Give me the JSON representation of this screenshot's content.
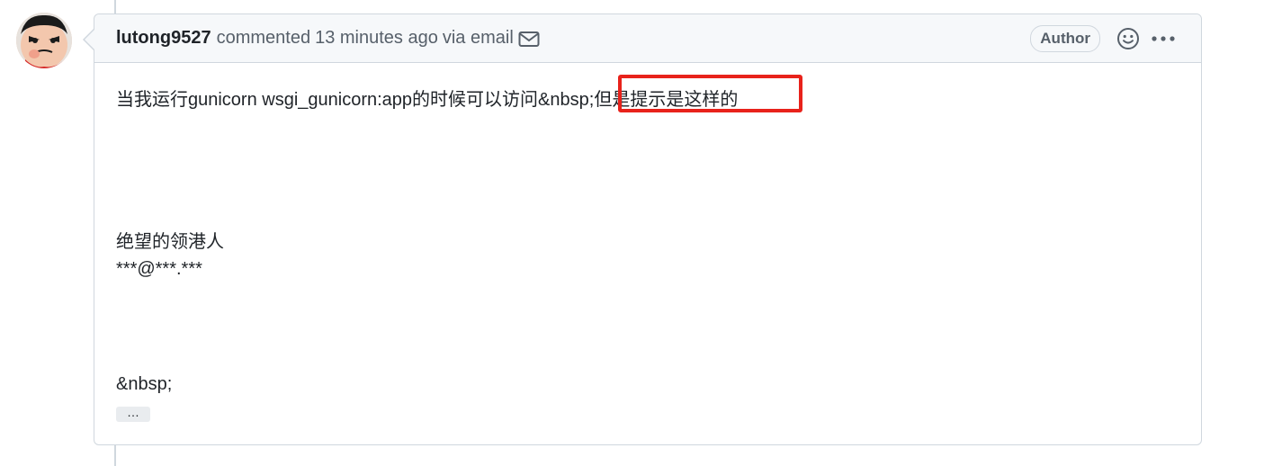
{
  "comment": {
    "author": "lutong9527",
    "action": "commented",
    "time": "13 minutes ago",
    "via": "via email",
    "badge": "Author",
    "body_line1_part1": "当我运行gunicorn wsgi_gunicorn:app的时候可以访问&nbsp;",
    "body_line1_part2": "但是提示是这样的",
    "signature_name": "绝望的领港人",
    "signature_email": "***@***.***",
    "nbsp_text": "&nbsp;",
    "ellipsis": "…"
  },
  "icons": {
    "mail": "mail-icon",
    "smiley": "smiley-icon",
    "more": "kebab-horizontal-icon"
  },
  "colors": {
    "highlight": "#e8221b",
    "border": "#d0d7de",
    "header_bg": "#f6f8fa",
    "muted_text": "#57606a"
  }
}
